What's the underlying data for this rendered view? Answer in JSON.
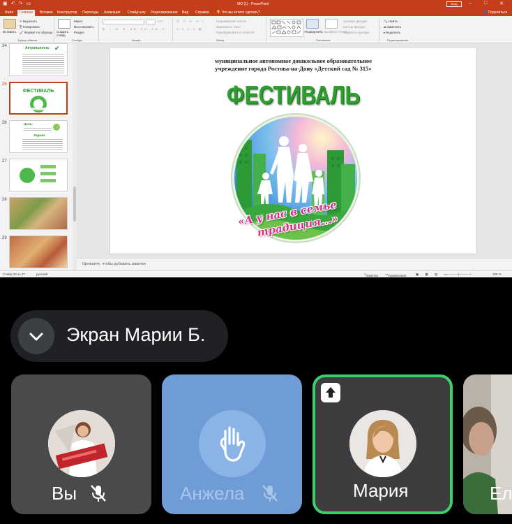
{
  "powerpoint": {
    "window_title": "МО (1) - PowerPoint",
    "signin_label": "Вход",
    "qat_icons": [
      "save-icon",
      "undo-icon",
      "redo-icon",
      "present-icon"
    ],
    "tabs": [
      "Файл",
      "Главная",
      "Вставка",
      "Конструктор",
      "Переходы",
      "Анимация",
      "Слайд-шоу",
      "Рецензирование",
      "Вид",
      "Справка"
    ],
    "active_tab": "Главная",
    "tell_me": "Что вы хотите сделать?",
    "share_label": "Поделиться",
    "ribbon": {
      "clipboard": {
        "paste": "Вставить",
        "cut": "Вырезать",
        "copy": "Копировать",
        "format_painter": "Формат по образцу",
        "group": "Буфер обмена"
      },
      "slides": {
        "new_slide": "Создать слайд",
        "layout": "Макет",
        "reset": "Восстановить",
        "section": "Раздел",
        "group": "Слайды"
      },
      "font": {
        "group": "Шрифт"
      },
      "paragraph": {
        "text_direction": "Направление текста",
        "align_text": "Выровнять текст",
        "smartart": "Преобразовать в SmartArt",
        "group": "Абзац"
      },
      "drawing": {
        "arrange": "Упорядочить",
        "quick_styles": "Экспресс-стили",
        "fill": "Заливка фигуры",
        "outline": "Контур фигуры",
        "effects": "Эффекты фигуры",
        "group": "Рисование"
      },
      "editing": {
        "find": "Найти",
        "replace": "Заменить",
        "select": "Выделить",
        "group": "Редактирование"
      }
    },
    "slide_numbers": [
      "24",
      "25",
      "26",
      "27",
      "28",
      "29"
    ],
    "thumb24_title": "Актуальность",
    "thumb25_title": "ФЕСТИВАЛЬ",
    "thumb26_title": "Цель:",
    "thumb26_subtitle": "Задачи:",
    "slide": {
      "header_line1": "муниципальное автономное дошкольное образовательное",
      "header_line2": "учреждение города Ростова-на-Дону «Детский сад № 315»",
      "title": "ФЕСТИВАЛЬ",
      "slogan_line1": "«А у нас в семье",
      "slogan_line2": "традиция...»"
    },
    "notes_placeholder": "Щелкните, чтобы добавить заметки",
    "status": {
      "slide_counter": "Слайд 25 из 37",
      "language": "русский",
      "notes": "Заметки",
      "comments": "Примечания",
      "zoom": "108 %"
    }
  },
  "meeting": {
    "screen_share_label": "Экран Марии Б.",
    "participants": [
      {
        "name": "Вы",
        "muted": true,
        "accent": "#4a4a4d"
      },
      {
        "name": "Анжела",
        "muted": true,
        "raised_hand": true,
        "accent": "#6f9bd6"
      },
      {
        "name": "Мария",
        "presenting": true,
        "active_speaker": true,
        "accent": "#3ecf6b"
      },
      {
        "name": "Ел"
      }
    ]
  },
  "colors": {
    "ppt_accent": "#c43e1c",
    "speaker_border": "#3ecf6b",
    "raised_hand_tile": "#6f9bd6",
    "slide_title_green": "#2e9e2e",
    "slogan_pink": "#d4338a"
  }
}
